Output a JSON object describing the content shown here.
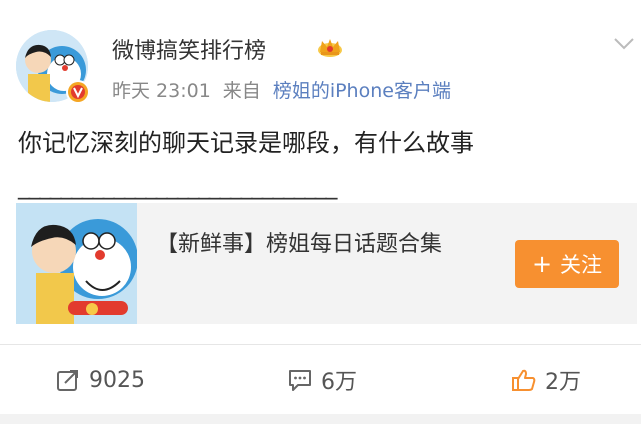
{
  "post": {
    "author": "微博搞笑排行榜",
    "time": "昨天 23:01",
    "source_prefix": "来自",
    "source_app": "榜姐的iPhone客户端",
    "text": "你记忆深刻的聊天记录是哪段，有什么故事",
    "divider": "______________________________"
  },
  "card": {
    "title": "【新鲜事】榜姐每日话题合集",
    "follow_label": "关注",
    "follow_plus": "+"
  },
  "actions": {
    "forward_count": "9025",
    "comment_count": "6万",
    "like_count": "2万"
  },
  "colors": {
    "accent_orange": "#f79030",
    "source_link": "#5b7fbf",
    "crown": "#f0a21a",
    "verified_badge": "#e23b2e"
  },
  "icons": {
    "author_badge": "crown-icon",
    "verified": "verified-badge-icon",
    "menu": "chevron-down-icon",
    "forward": "forward-icon",
    "comment": "comment-icon",
    "like": "thumbs-up-icon"
  }
}
